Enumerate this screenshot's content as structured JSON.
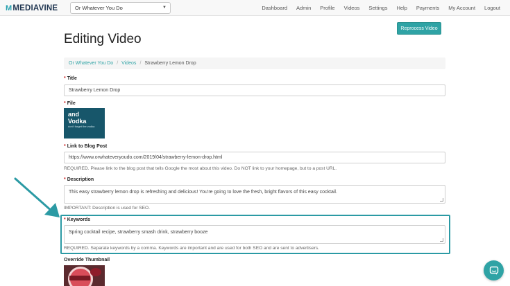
{
  "navbar": {
    "logo_mark": "M",
    "logo_text": "MEDIAVINE",
    "site_select_value": "Or Whatever You Do",
    "links": [
      "Dashboard",
      "Admin",
      "Profile",
      "Videos",
      "Settings",
      "Help",
      "Payments",
      "My Account",
      "Logout"
    ]
  },
  "reprocess_label": "Reprocess Video",
  "page_title": "Editing Video",
  "breadcrumb": {
    "site": "Or Whatever You Do",
    "section": "Videos",
    "current": "Strawberry Lemon Drop",
    "separator": "/"
  },
  "form": {
    "required_mark": "*",
    "title": {
      "label": "Title",
      "value": "Strawberry Lemon Drop"
    },
    "file": {
      "label": "File",
      "thumb_line1": "and",
      "thumb_line2": "Vodka",
      "thumb_line3": "don't forget the vodka"
    },
    "link": {
      "label": "Link to Blog Post",
      "value": "https://www.orwhateveryoudo.com/2019/04/strawberry-lemon-drop.html",
      "help": "REQUIRED. Please link to the blog post that tells Google the most about this video. Do NOT link to your homepage, but to a post URL."
    },
    "description": {
      "label": "Description",
      "value": "This easy strawberry lemon drop is refreshing and delicious! You're going to love the fresh, bright flavors of this easy cocktail.",
      "help": "IMPORTANT: Description is used for SEO."
    },
    "keywords": {
      "label": "Keywords",
      "value": "Spring cocktail recipe, strawberry smash drink, strawberry booze",
      "help": "REQUIRED. Separate keywords by a comma. Keywords are important and are used for both SEO and are sent to advertisers."
    },
    "override_thumbnail": {
      "label": "Override Thumbnail"
    }
  },
  "colors": {
    "accent": "#2fa3a5",
    "highlight": "#2b9aa4",
    "required": "#cc2222"
  },
  "icons": {
    "chat": "chat-bubble-icon",
    "select_caret": "caret-down-icon",
    "annotation_arrow": "arrow-pointer-icon"
  }
}
